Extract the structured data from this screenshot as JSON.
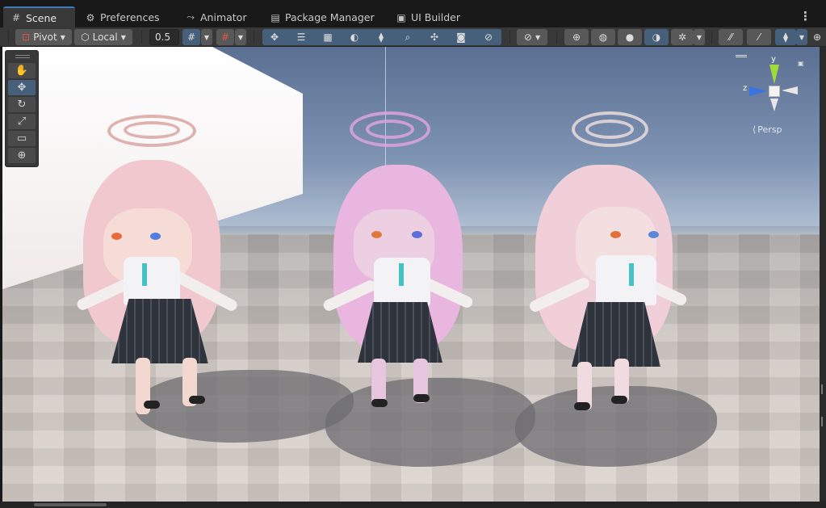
{
  "tabs": [
    {
      "label": "Scene",
      "icon": "hash-grid-icon",
      "active": true
    },
    {
      "label": "Preferences",
      "icon": "gear-icon"
    },
    {
      "label": "Animator",
      "icon": "animator-icon"
    },
    {
      "label": "Package Manager",
      "icon": "package-icon"
    },
    {
      "label": "UI Builder",
      "icon": "ui-builder-icon"
    }
  ],
  "toolbar": {
    "pivot_label": "Pivot",
    "local_label": "Local",
    "snap_value": "0.5"
  },
  "scene_view": {
    "camera_mode": "Persp",
    "axis_y": "y",
    "axis_z": "z"
  },
  "colors": {
    "accent": "#3a79bb",
    "toggle_on": "#46607c",
    "panel": "#383838",
    "background": "#191919"
  },
  "tool_palette": [
    {
      "name": "hand-tool",
      "icon": "✋"
    },
    {
      "name": "move-tool",
      "icon": "✥",
      "active": true
    },
    {
      "name": "rotate-tool",
      "icon": "↻"
    },
    {
      "name": "scale-tool",
      "icon": "⤢"
    },
    {
      "name": "rect-tool",
      "icon": "▭"
    },
    {
      "name": "transform-tool",
      "icon": "⊕"
    }
  ]
}
